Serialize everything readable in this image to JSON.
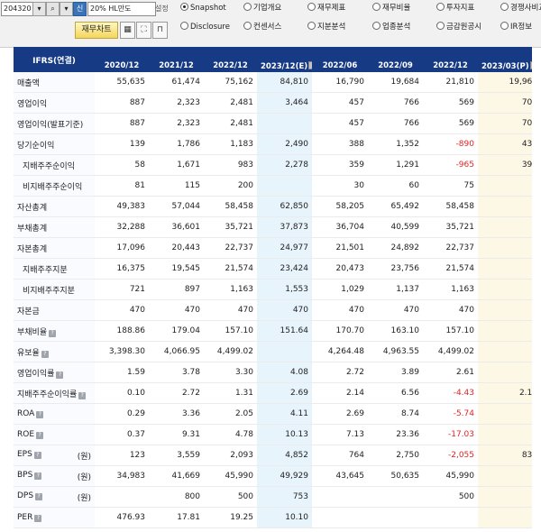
{
  "toolbar": {
    "code": "204320",
    "search_icon": "search-icon",
    "sin_label": "신",
    "stock_name": "20% HL만도",
    "settings_label": "설정",
    "fin_chart_label": "재무차트",
    "radios_row1": [
      {
        "label": "Snapshot",
        "selected": true
      },
      {
        "label": "기업개요",
        "selected": false
      },
      {
        "label": "재무제표",
        "selected": false
      },
      {
        "label": "재무비율",
        "selected": false
      },
      {
        "label": "투자지표",
        "selected": false
      },
      {
        "label": "경쟁사비교",
        "selected": false
      }
    ],
    "radios_row2": [
      {
        "label": "Disclosure",
        "selected": false
      },
      {
        "label": "컨센서스",
        "selected": false
      },
      {
        "label": "지분분석",
        "selected": false
      },
      {
        "label": "업종분석",
        "selected": false
      },
      {
        "label": "금감원공시",
        "selected": false
      },
      {
        "label": "IR정보",
        "selected": false
      }
    ]
  },
  "table": {
    "corner": "IFRS(연결)",
    "columns": [
      "2020/12",
      "2021/12",
      "2022/12",
      "2023/12(E)",
      "2022/06",
      "2022/09",
      "2022/12",
      "2023/03(P)"
    ],
    "rows": [
      {
        "label": "매출액",
        "values": [
          "55,635",
          "61,474",
          "75,162",
          "84,810",
          "16,790",
          "19,684",
          "21,810",
          "19,968"
        ]
      },
      {
        "label": "영업이익",
        "values": [
          "887",
          "2,323",
          "2,481",
          "3,464",
          "457",
          "766",
          "569",
          "702"
        ]
      },
      {
        "label": "영업이익(발표기준)",
        "values": [
          "887",
          "2,323",
          "2,481",
          "",
          "457",
          "766",
          "569",
          "702"
        ]
      },
      {
        "label": "당기순이익",
        "values": [
          "139",
          "1,786",
          "1,183",
          "2,490",
          "388",
          "1,352",
          "-890",
          "437"
        ]
      },
      {
        "label": "지배주주순이익",
        "values": [
          "58",
          "1,671",
          "983",
          "2,278",
          "359",
          "1,291",
          "-965",
          "394"
        ]
      },
      {
        "label": "비지배주주순이익",
        "values": [
          "81",
          "115",
          "200",
          "",
          "30",
          "60",
          "75",
          ""
        ]
      },
      {
        "label": "자산총계",
        "values": [
          "49,383",
          "57,044",
          "58,458",
          "62,850",
          "58,205",
          "65,492",
          "58,458",
          ""
        ]
      },
      {
        "label": "부채총계",
        "values": [
          "32,288",
          "36,601",
          "35,721",
          "37,873",
          "36,704",
          "40,599",
          "35,721",
          ""
        ]
      },
      {
        "label": "자본총계",
        "values": [
          "17,096",
          "20,443",
          "22,737",
          "24,977",
          "21,501",
          "24,892",
          "22,737",
          ""
        ]
      },
      {
        "label": "지배주주지분",
        "values": [
          "16,375",
          "19,545",
          "21,574",
          "23,424",
          "20,473",
          "23,756",
          "21,574",
          ""
        ]
      },
      {
        "label": "비지배주주지분",
        "values": [
          "721",
          "897",
          "1,163",
          "1,553",
          "1,029",
          "1,137",
          "1,163",
          ""
        ]
      },
      {
        "label": "자본금",
        "values": [
          "470",
          "470",
          "470",
          "470",
          "470",
          "470",
          "470",
          ""
        ]
      },
      {
        "label": "부채비율",
        "values": [
          "188.86",
          "179.04",
          "157.10",
          "151.64",
          "170.70",
          "163.10",
          "157.10",
          ""
        ]
      },
      {
        "label": "유보율",
        "values": [
          "3,398.30",
          "4,066.95",
          "4,499.02",
          "",
          "4,264.48",
          "4,963.55",
          "4,499.02",
          ""
        ]
      },
      {
        "label": "영업이익률",
        "values": [
          "1.59",
          "3.78",
          "3.30",
          "4.08",
          "2.72",
          "3.89",
          "2.61",
          ""
        ]
      },
      {
        "label": "지배주주순이익률",
        "values": [
          "0.10",
          "2.72",
          "1.31",
          "2.69",
          "2.14",
          "6.56",
          "-4.43",
          "2.19"
        ]
      },
      {
        "label": "ROA",
        "values": [
          "0.29",
          "3.36",
          "2.05",
          "4.11",
          "2.69",
          "8.74",
          "-5.74",
          ""
        ]
      },
      {
        "label": "ROE",
        "values": [
          "0.37",
          "9.31",
          "4.78",
          "10.13",
          "7.13",
          "23.36",
          "-17.03",
          ""
        ]
      },
      {
        "label": "EPS",
        "unit": "(원)",
        "values": [
          "123",
          "3,559",
          "2,093",
          "4,852",
          "764",
          "2,750",
          "-2,055",
          "838"
        ]
      },
      {
        "label": "BPS",
        "unit": "(원)",
        "values": [
          "34,983",
          "41,669",
          "45,990",
          "49,929",
          "43,645",
          "50,635",
          "45,990",
          ""
        ]
      },
      {
        "label": "DPS",
        "unit": "(원)",
        "values": [
          "",
          "800",
          "500",
          "753",
          "",
          "",
          "500",
          ""
        ]
      },
      {
        "label": "PER",
        "values": [
          "476.93",
          "17.81",
          "19.25",
          "10.10",
          "",
          "",
          "",
          ""
        ]
      }
    ]
  }
}
